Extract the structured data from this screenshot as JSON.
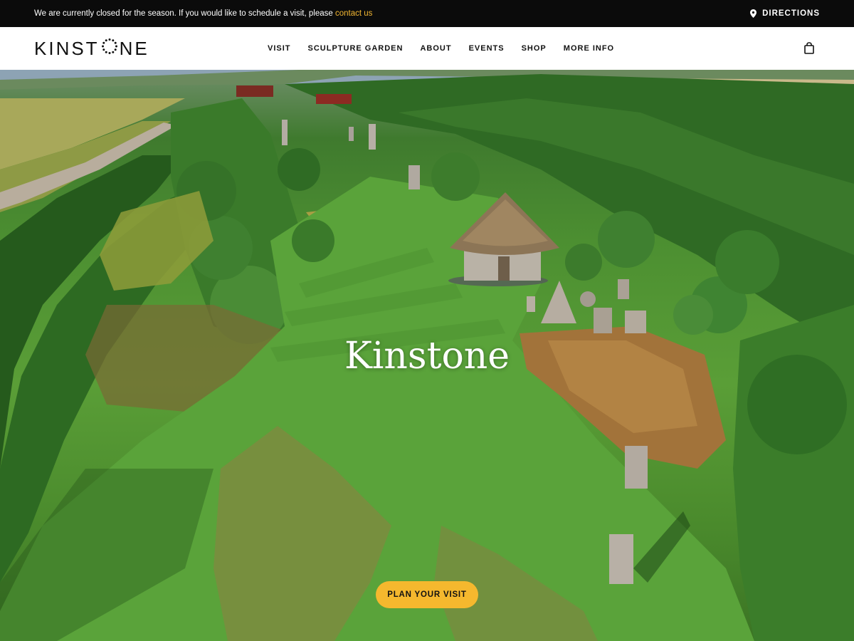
{
  "announcement": {
    "message": "We are currently closed for the season. If you would like to schedule a visit, please ",
    "link_text": "contact us",
    "directions_label": "DIRECTIONS"
  },
  "brand": {
    "logo_left": "KINST",
    "logo_right": "NE"
  },
  "nav": {
    "items": [
      {
        "label": "VISIT"
      },
      {
        "label": "SCULPTURE GARDEN"
      },
      {
        "label": "ABOUT"
      },
      {
        "label": "EVENTS"
      },
      {
        "label": "SHOP"
      },
      {
        "label": "MORE INFO"
      }
    ],
    "cart_icon": "shopping-bag-icon"
  },
  "hero": {
    "title": "Kinstone",
    "cta_label": "PLAN YOUR VISIT"
  },
  "colors": {
    "accent": "#f5b82e",
    "link": "#f2b632",
    "topbar": "#0b0b0b",
    "grass": "#4c8f31"
  }
}
